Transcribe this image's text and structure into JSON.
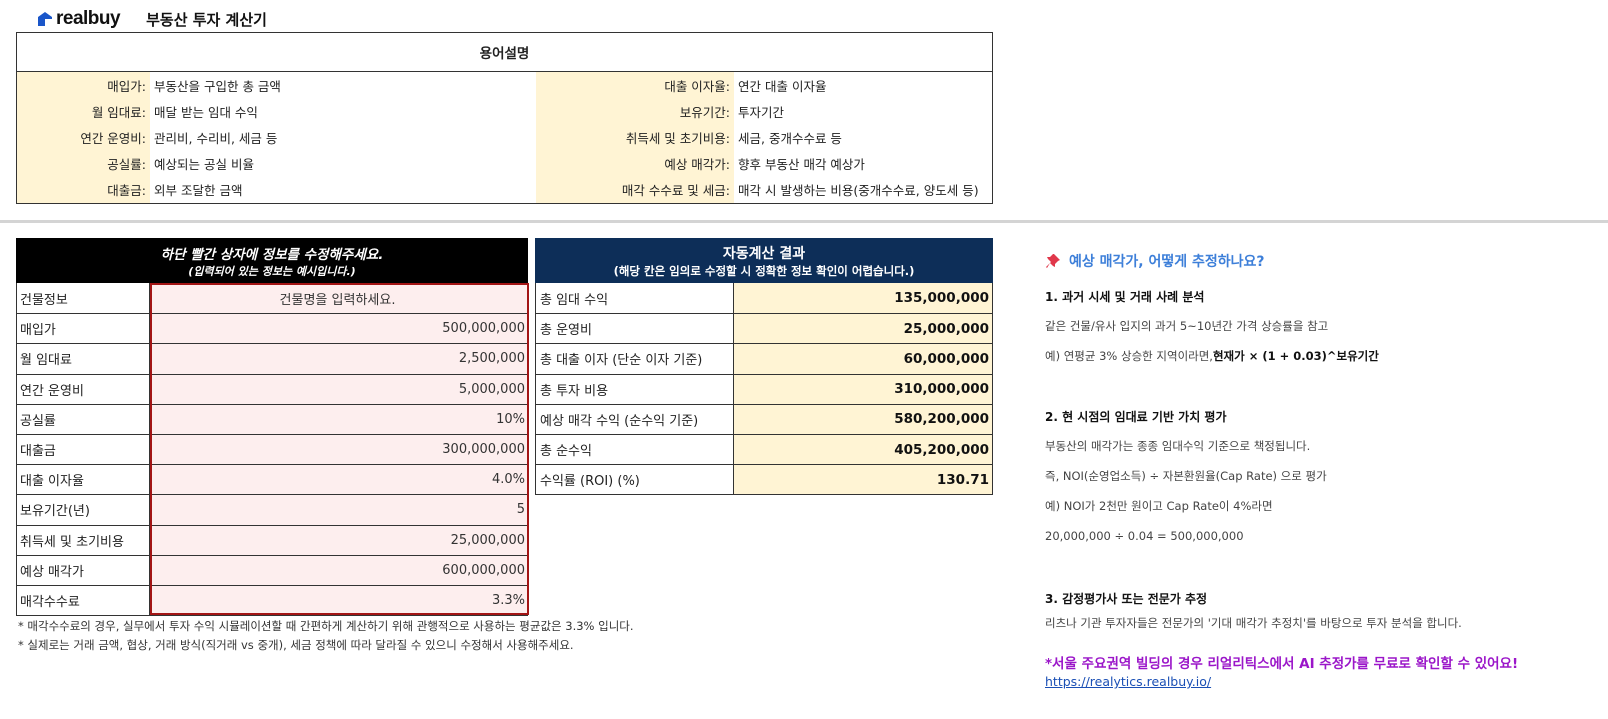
{
  "header": {
    "logo_text": "realbuy",
    "title": "부동산 투자 계산기"
  },
  "glossary": {
    "title": "용어설명",
    "left": [
      {
        "term": "매입가:",
        "desc": "부동산을 구입한 총 금액"
      },
      {
        "term": "월 임대료:",
        "desc": "매달 받는 임대 수익"
      },
      {
        "term": "연간 운영비:",
        "desc": "관리비, 수리비, 세금 등"
      },
      {
        "term": "공실률:",
        "desc": "예상되는 공실 비율"
      },
      {
        "term": "대출금:",
        "desc": "외부 조달한 금액"
      }
    ],
    "right": [
      {
        "term": "대출 이자율:",
        "desc": "연간 대출 이자율"
      },
      {
        "term": "보유기간:",
        "desc": "투자기간"
      },
      {
        "term": "취득세 및 초기비용:",
        "desc": "세금, 중개수수료 등"
      },
      {
        "term": "예상 매각가:",
        "desc": "향후 부동산 매각 예상가"
      },
      {
        "term": "매각 수수료 및 세금:",
        "desc": "매각 시 발생하는 비용(중개수수료, 양도세 등)"
      }
    ]
  },
  "input_table": {
    "header_line1": "하단 빨간 상자에 정보를 수정해주세요.",
    "header_line2": "(입력되어 있는 정보는 예시입니다.)",
    "rows": [
      {
        "label": "건물정보",
        "value": "건물명을 입력하세요."
      },
      {
        "label": "매입가",
        "value": "500,000,000"
      },
      {
        "label": "월 임대료",
        "value": "2,500,000"
      },
      {
        "label": "연간 운영비",
        "value": "5,000,000"
      },
      {
        "label": "공실률",
        "value": "10%"
      },
      {
        "label": "대출금",
        "value": "300,000,000"
      },
      {
        "label": "대출 이자율",
        "value": "4.0%"
      },
      {
        "label": "보유기간(년)",
        "value": "5"
      },
      {
        "label": "취득세 및 초기비용",
        "value": "25,000,000"
      },
      {
        "label": "예상 매각가",
        "value": "600,000,000"
      },
      {
        "label": "매각수수료",
        "value": "3.3%"
      }
    ]
  },
  "notes": [
    "* 매각수수료의 경우, 실무에서 투자 수익 시뮬레이션할 때 간편하게 계산하기 위해 관행적으로 사용하는 평균값은 3.3% 입니다.",
    "* 실제로는 거래 금액, 협상, 거래 방식(직거래 vs 중개), 세금 정책에 따라 달라질 수 있으니 수정해서 사용해주세요."
  ],
  "result_table": {
    "header_line1": "자동계산 결과",
    "header_line2": "(해당 칸은 임의로 수정할 시 정확한 정보 확인이 어렵습니다.)",
    "rows": [
      {
        "label": "총 임대 수익",
        "value": "135,000,000"
      },
      {
        "label": "총 운영비",
        "value": "25,000,000"
      },
      {
        "label": "총 대출 이자 (단순 이자 기준)",
        "value": "60,000,000"
      },
      {
        "label": "총 투자 비용",
        "value": "310,000,000"
      },
      {
        "label": "예상 매각 수익 (순수익 기준)",
        "value": "580,200,000"
      },
      {
        "label": "총 순수익",
        "value": "405,200,000"
      },
      {
        "label": "수익률 (ROI) (%)",
        "value": "130.71"
      }
    ]
  },
  "guide": {
    "title": "예상 매각가, 어떻게 추정하나요?",
    "s1_head": "1. 과거 시세 및 거래 사례 분석",
    "s1_line1": "같은 건물/유사 입지의 과거 5~10년간 가격 상승률을 참고",
    "s1_line2_a": "예) 연평균 3% 상승한 지역이라면, ",
    "s1_line2_b": "현재가 × (1 + 0.03)^보유기간",
    "s2_head": "2. 현 시점의 임대료 기반 가치 평가",
    "s2_line1": "부동산의 매각가는 종종 임대수익 기준으로 책정됩니다.",
    "s2_line2": "즉, NOI(순영업소득) ÷ 자본환원율(Cap Rate) 으로 평가",
    "s2_line3": "예) NOI가 2천만 원이고 Cap Rate이 4%라면",
    "s2_line4": "20,000,000 ÷ 0.04 = 500,000,000",
    "s3_head": "3. 감정평가사 또는 전문가 추정",
    "s3_line1": "리츠나 기관 투자자들은 전문가의 '기대 매각가 추정치'를 바탕으로 투자 분석을 합니다.",
    "promo": "*서울 주요권역 빌딩의 경우 리얼리틱스에서 AI 추정가를 무료로 확인할 수 있어요!",
    "link": "https://realytics.realbuy.io/"
  },
  "colors": {
    "input_header_bg": "#000000",
    "result_header_bg": "#0d2e58",
    "input_cell_bg": "#fdeeee",
    "highlight_bg": "#fff4d4",
    "red_frame": "#a31515",
    "guide_title": "#3d7fd9",
    "promo": "#9b16c9"
  }
}
